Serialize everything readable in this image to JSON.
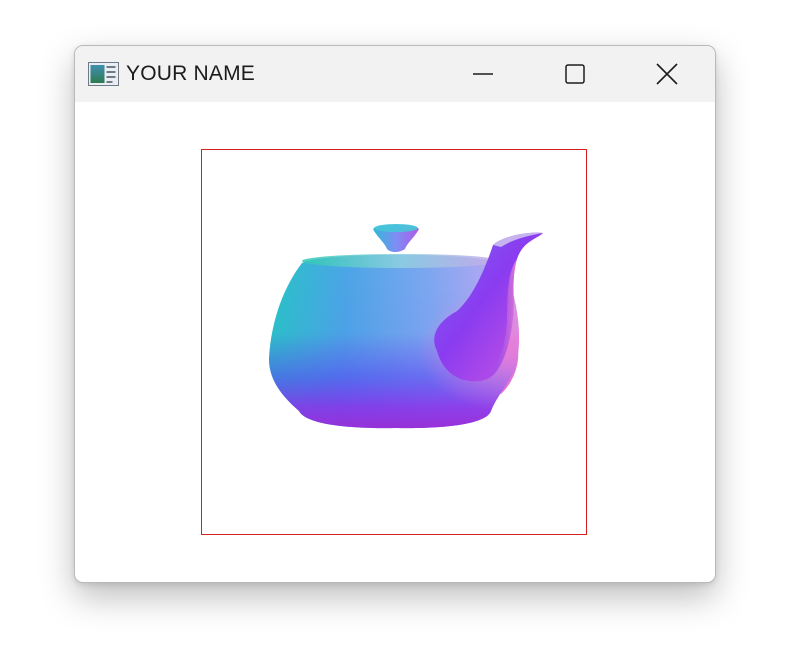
{
  "window": {
    "title": "YOUR NAME",
    "icon": "application-window-icon",
    "controls": {
      "minimize": "minimize-icon",
      "maximize": "maximize-icon",
      "close": "close-icon"
    }
  },
  "viewport": {
    "border_color": "#d42020",
    "content": "normal-shaded-teapot",
    "palette": [
      "#27c6c6",
      "#7fa8f0",
      "#5a52f4",
      "#8a2ee8",
      "#c455e8",
      "#ee7ad6"
    ]
  }
}
